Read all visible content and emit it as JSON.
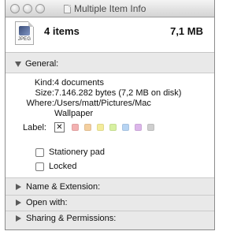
{
  "window": {
    "title": "Multiple Item Info"
  },
  "summary": {
    "icon_label": "JPEG",
    "item_count": "4 items",
    "total_size": "7,1 MB"
  },
  "general": {
    "header": "General:",
    "kind_label": "Kind:",
    "kind_value": "4 documents",
    "size_label": "Size:",
    "size_value": "7.146.282 bytes (7,2 MB on disk)",
    "where_label": "Where:",
    "where_value_line1": "/Users/matt/Pictures/Mac",
    "where_value_line2": "Wallpaper",
    "label_label": "Label:",
    "label_none_symbol": "✕",
    "label_colors": [
      "#f3b1b1",
      "#f4cf9f",
      "#f4ec9b",
      "#d7f0a1",
      "#b7d4f3",
      "#dcb6ea",
      "#cfcfcf"
    ],
    "stationery_label": "Stationery pad",
    "locked_label": "Locked"
  },
  "sections": {
    "name_extension": "Name & Extension:",
    "open_with": "Open with:",
    "sharing": "Sharing & Permissions:"
  }
}
